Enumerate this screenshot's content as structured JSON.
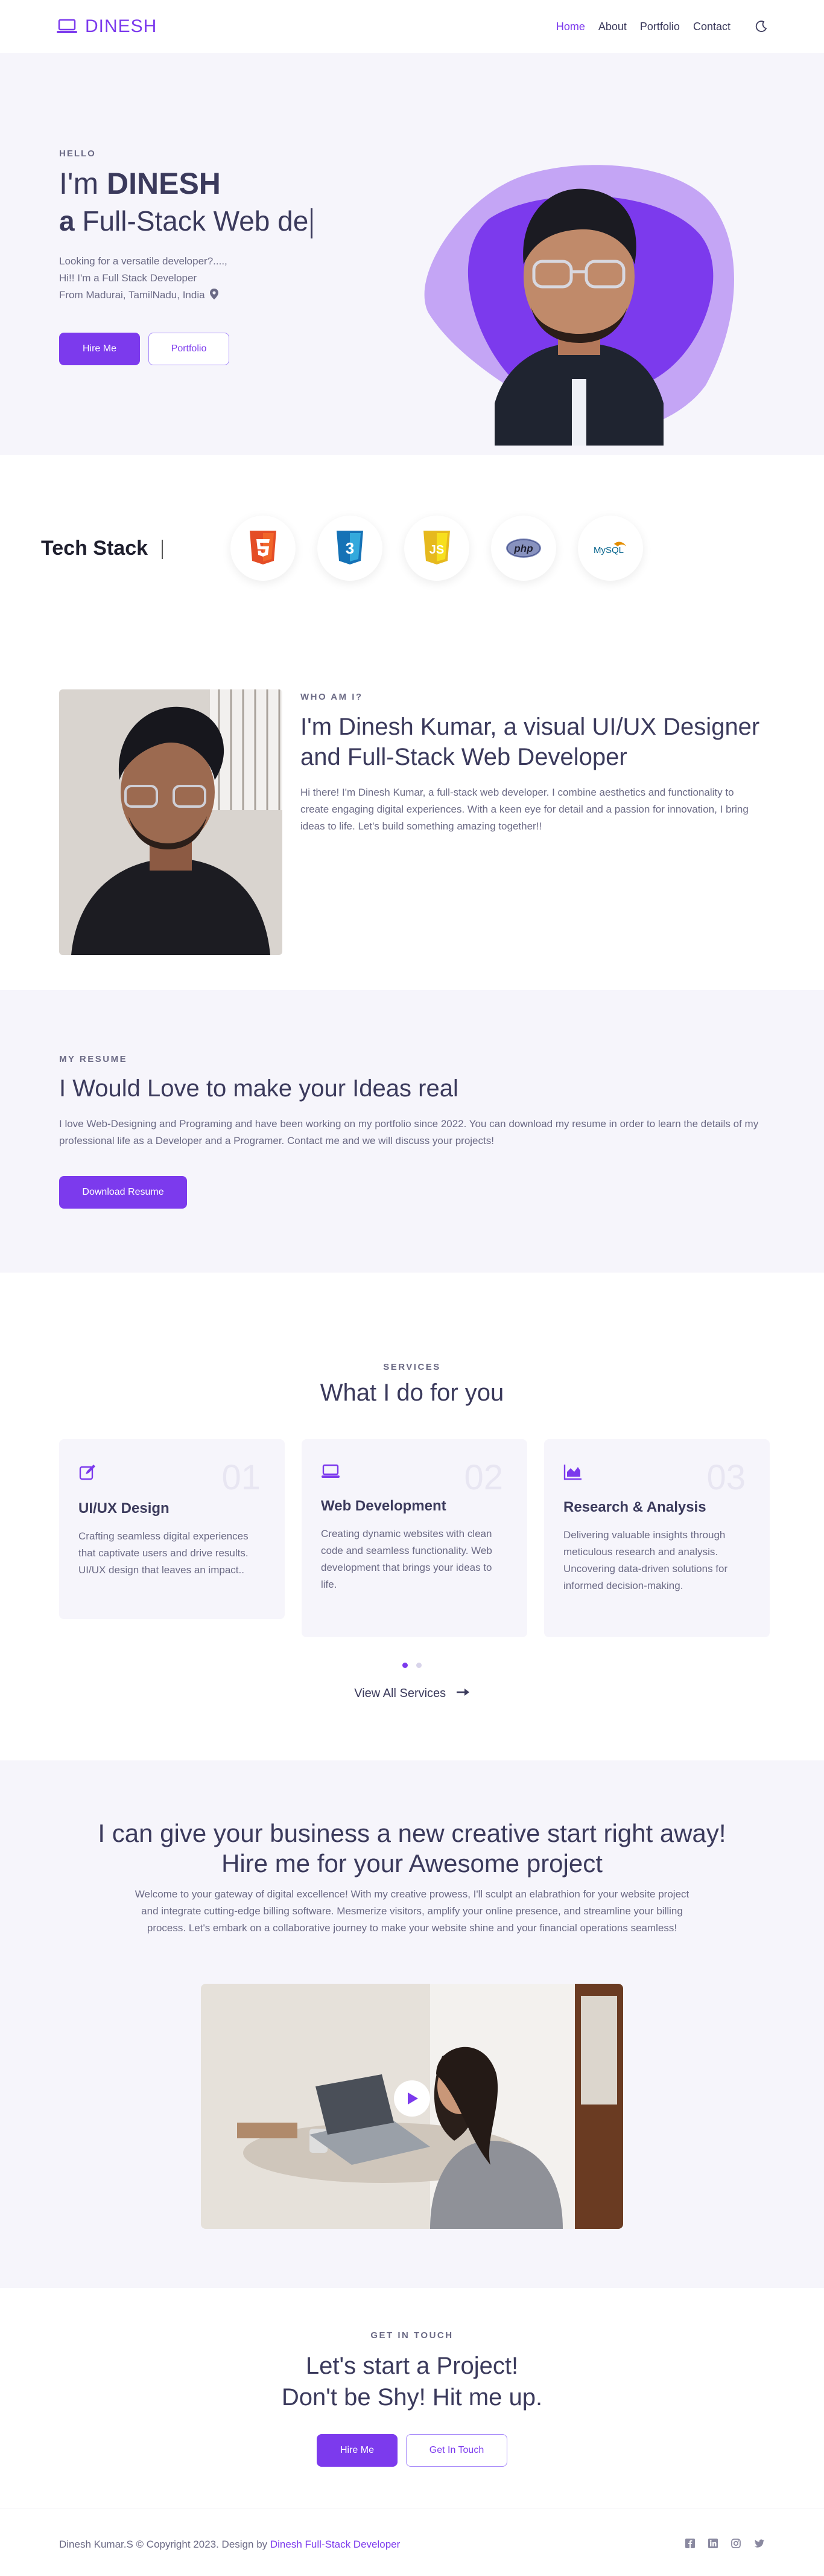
{
  "nav": {
    "brand": "DINESH",
    "items": [
      {
        "label": "Home",
        "active": true
      },
      {
        "label": "About",
        "active": false
      },
      {
        "label": "Portfolio",
        "active": false
      },
      {
        "label": "Contact",
        "active": false
      }
    ],
    "theme_icon": "moon-icon"
  },
  "hero": {
    "eyebrow": "HELLO",
    "greeting_prefix": "I'm ",
    "greeting_name": "DINESH",
    "typed_prefix": "a",
    "typed_text": " Full-Stack Web de",
    "line1": "Looking for a versatile developer?....,",
    "line2": "Hi!! I'm a Full Stack Developer",
    "line3": "From Madurai, TamilNadu, India",
    "hire_label": "Hire Me",
    "portfolio_label": "Portfolio"
  },
  "tech": {
    "title": "Tech Stack",
    "icons": [
      "html5-icon",
      "css3-icon",
      "javascript-icon",
      "php-icon",
      "mysql-icon"
    ],
    "css3_label": "3",
    "js_label": "JS",
    "php_label": "php",
    "mysql_label": "MySQL"
  },
  "about": {
    "eyebrow": "WHO AM I?",
    "title": "I'm Dinesh Kumar, a visual UI/UX Designer and Full-Stack Web Developer",
    "body": "Hi there! I'm Dinesh Kumar, a full-stack web developer. I combine aesthetics and functionality to create engaging digital experiences. With a keen eye for detail and a passion for innovation, I bring ideas to life. Let's build something amazing together!!"
  },
  "resume": {
    "eyebrow": "MY RESUME",
    "title": "I Would Love to make your Ideas real",
    "body": "I love Web-Designing and Programing and have been working on my portfolio since 2022. You can download my resume in order to learn the details of my professional life as a Developer and a Programer. Contact me and we will discuss your projects!",
    "button": "Download Resume"
  },
  "services": {
    "eyebrow": "SERVICES",
    "title": "What I do for you",
    "cards": [
      {
        "num": "01",
        "title": "UI/UX Design",
        "body": "Crafting seamless digital experiences that captivate users and drive results. UI/UX design that leaves an impact..",
        "icon": "edit-icon"
      },
      {
        "num": "02",
        "title": "Web Development",
        "body": "Creating dynamic websites with clean code and seamless functionality. Web development that brings your ideas to life.",
        "icon": "laptop-icon"
      },
      {
        "num": "03",
        "title": "Research & Analysis",
        "body": "Delivering valuable insights through meticulous research and analysis. Uncovering data-driven solutions for informed decision-making.",
        "icon": "chart-icon"
      }
    ],
    "view_all": "View All Services"
  },
  "cta": {
    "title_line1": "I can give your business a new creative start right away!",
    "title_line2": "Hire me for your Awesome project",
    "body": "Welcome to your gateway of digital excellence! With my creative prowess, I'll sculpt an elabrathion for your website project and integrate cutting-edge billing software. Mesmerize visitors, amplify your online presence, and streamline your billing process. Let's embark on a collaborative journey to make your website shine and your financial operations seamless!"
  },
  "contact": {
    "eyebrow": "GET IN TOUCH",
    "title_line1": "Let's start a Project!",
    "title_line2": "Don't be Shy! Hit me up.",
    "hire_label": "Hire Me",
    "touch_label": "Get In Touch"
  },
  "footer": {
    "copy": "Dinesh Kumar.S © Copyright 2023. Design by ",
    "link": "Dinesh Full-Stack Developer",
    "socials": [
      "facebook-icon",
      "linkedin-icon",
      "instagram-icon",
      "twitter-icon"
    ]
  },
  "colors": {
    "accent": "#7c3aed",
    "accent_light": "#c4a5f5",
    "bg_soft": "#f6f5fb",
    "text": "#3b3a5c"
  }
}
